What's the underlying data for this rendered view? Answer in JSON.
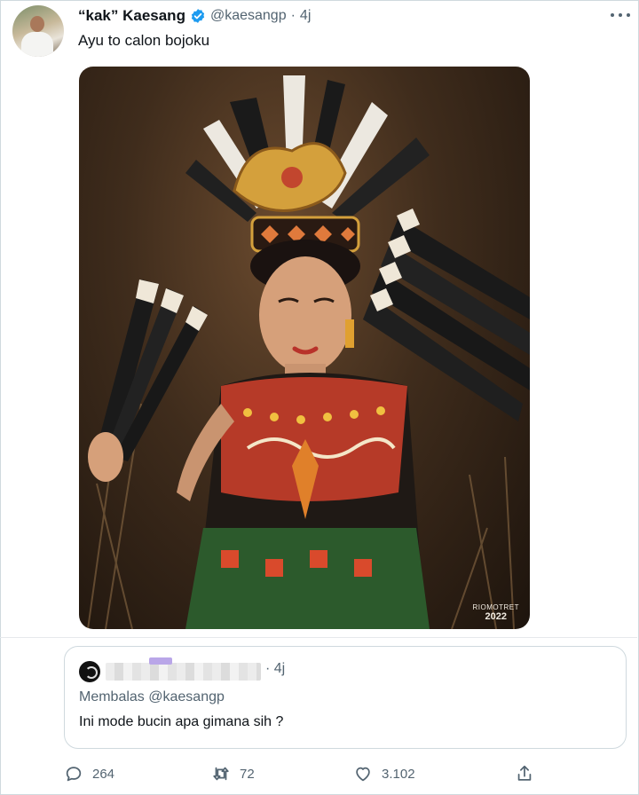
{
  "tweet": {
    "display_name": "“kak” Kaesang",
    "handle": "@kaesangp",
    "separator": "·",
    "time": "4j",
    "text": "Ayu to calon bojoku",
    "photo": {
      "watermark_line1": "RIOMOTRET",
      "watermark_line2": "2022"
    }
  },
  "quote": {
    "time": "· 4j",
    "reply_context": "Membalas @kaesangp",
    "text": "Ini mode bucin apa gimana sih ?"
  },
  "actions": {
    "reply_count": "264",
    "retweet_count": "72",
    "like_count": "3.102"
  },
  "colors": {
    "verified": "#1d9bf0",
    "secondary_text": "#536471",
    "primary_text": "#0f1419",
    "border": "#cfd9de"
  },
  "icons": [
    "verified-badge-icon",
    "more-icon",
    "reply-icon",
    "retweet-icon",
    "like-icon",
    "share-icon"
  ]
}
